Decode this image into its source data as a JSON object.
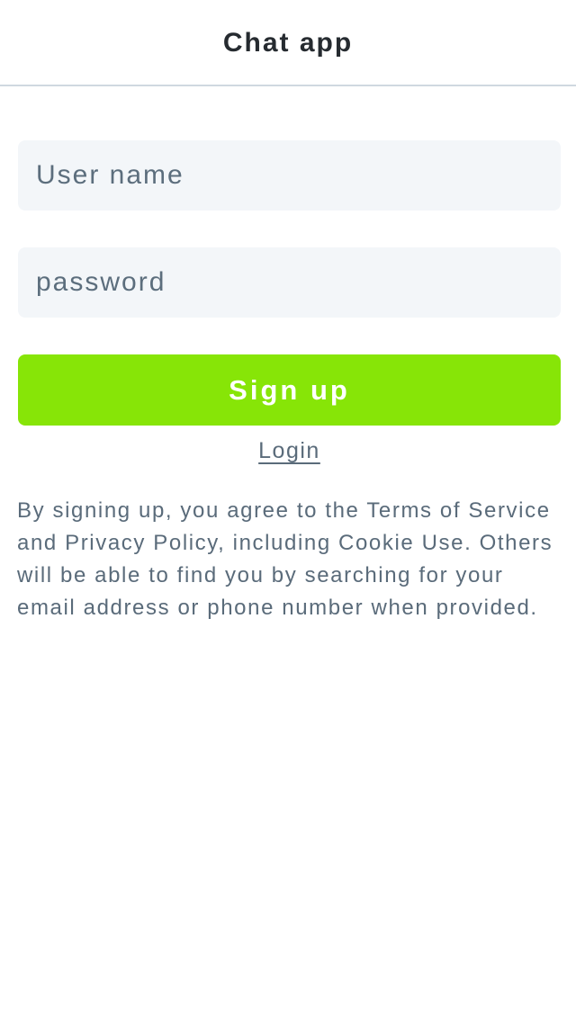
{
  "header": {
    "title": "Chat app"
  },
  "form": {
    "username_placeholder": "User name",
    "username_value": "",
    "password_placeholder": "password",
    "password_value": "",
    "signup_label": "Sign up",
    "login_label": "Login"
  },
  "terms": {
    "text": "By signing up, you agree to the Terms of Service and Privacy Policy, including Cookie Use. Others will be able to find you by searching for your email address or phone number when provided."
  },
  "colors": {
    "accent": "#87e507",
    "field_bg": "#f3f6f9",
    "muted_text": "#5a6b7a",
    "divider": "#cfd8e0"
  }
}
